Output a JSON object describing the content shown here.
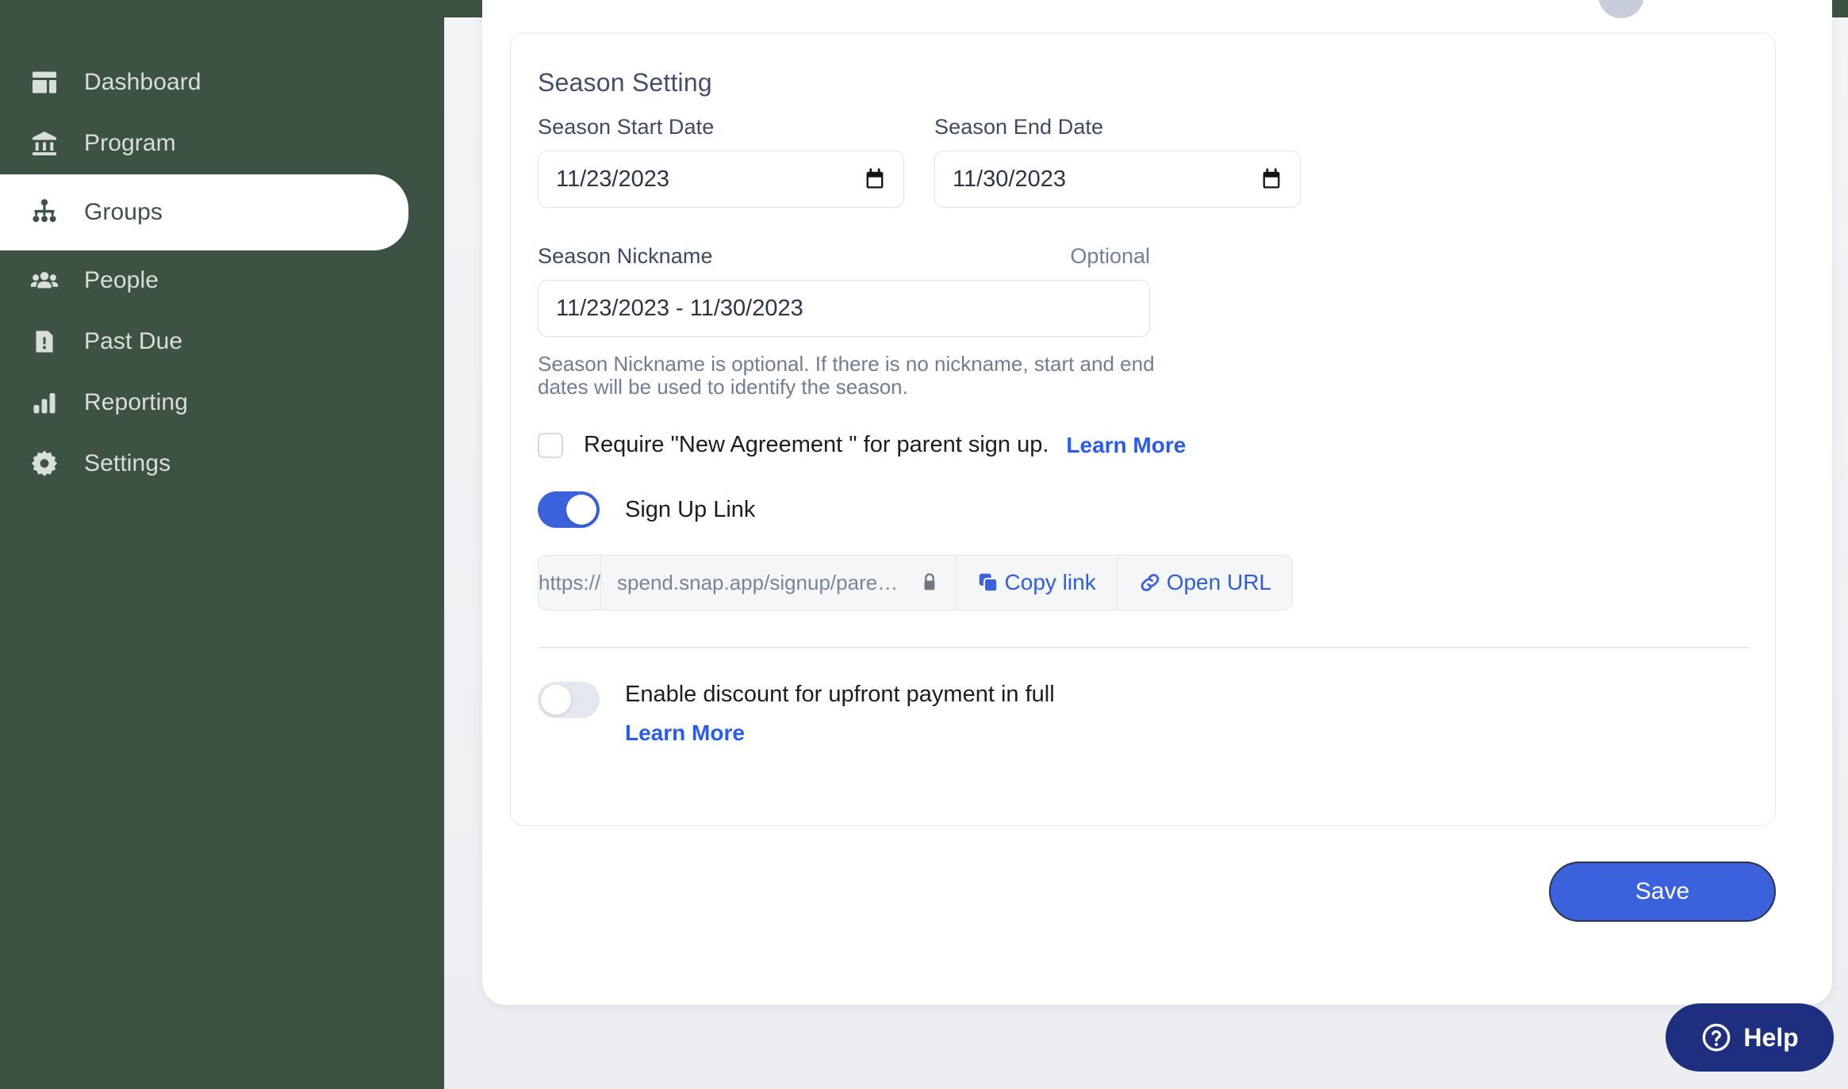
{
  "colors": {
    "sidebar_green": "#3E5244",
    "accent_blue": "#3B61DD",
    "link_blue": "#2A5BEF",
    "help_navy": "#1F2F7F",
    "page_bg": "#F3F4F6"
  },
  "sidebar": {
    "items": [
      {
        "label": "Dashboard",
        "icon": "dashboard-icon",
        "active": false
      },
      {
        "label": "Program",
        "icon": "bank-icon",
        "active": false
      },
      {
        "label": "Groups",
        "icon": "groups-icon",
        "active": true
      },
      {
        "label": "People",
        "icon": "people-icon",
        "active": false
      },
      {
        "label": "Past Due",
        "icon": "alert-icon",
        "active": false
      },
      {
        "label": "Reporting",
        "icon": "bar-chart-icon",
        "active": false
      },
      {
        "label": "Settings",
        "icon": "gear-icon",
        "active": false
      }
    ]
  },
  "card": {
    "title": "Season Setting",
    "start_date": {
      "label": "Season Start Date",
      "value": "11/23/2023"
    },
    "end_date": {
      "label": "Season End Date",
      "value": "11/30/2023"
    },
    "nickname": {
      "label": "Season Nickname",
      "optional_tag": "Optional",
      "value": "11/23/2023 - 11/30/2023",
      "helper": "Season Nickname is optional. If there is no nickname, start and end dates will be used to identify the season."
    },
    "agreement": {
      "label": "Require \"New Agreement \" for parent sign up.",
      "learn_more": "Learn More",
      "checked": false
    },
    "signup_link": {
      "label": "Sign Up Link",
      "enabled": true,
      "scheme": "https://",
      "url": "spend.snap.app/signup/parents/organization/s...",
      "copy_label": "Copy link",
      "open_label": "Open URL"
    },
    "discount": {
      "label": "Enable discount for upfront payment in full",
      "learn_more": "Learn More",
      "enabled": false
    }
  },
  "actions": {
    "save_label": "Save",
    "help_label": "Help"
  }
}
